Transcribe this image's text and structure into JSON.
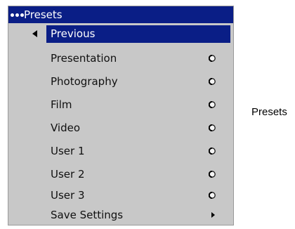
{
  "menu": {
    "title": "Presets",
    "colors": {
      "highlight": "#0a1e86",
      "panel": "#c8c8c8"
    },
    "back_item": {
      "label": "Previous",
      "icon": "left-triangle-icon"
    },
    "items": [
      {
        "label": "Presentation",
        "icon": "radio-icon"
      },
      {
        "label": "Photography",
        "icon": "radio-icon"
      },
      {
        "label": "Film",
        "icon": "radio-icon"
      },
      {
        "label": "Video",
        "icon": "radio-icon"
      },
      {
        "label": "User 1",
        "icon": "radio-icon"
      },
      {
        "label": "User 2",
        "icon": "radio-icon"
      },
      {
        "label": "User 3",
        "icon": "radio-icon"
      }
    ],
    "submenu_item": {
      "label": "Save Settings",
      "icon": "right-triangle-icon"
    }
  },
  "caption": "Presets"
}
